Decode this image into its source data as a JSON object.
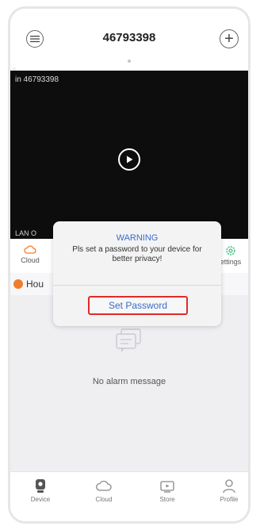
{
  "header": {
    "title": "46793398",
    "add_glyph": "+"
  },
  "video": {
    "device_id": "in 46793398",
    "status": "LAN O"
  },
  "actions": {
    "left_label": "Cloud",
    "right_label": "ettings"
  },
  "alarm": {
    "section_label": "Hou",
    "empty_message": "No alarm message"
  },
  "dialog": {
    "title": "WARNING",
    "message": "Pls set a password to your device for better privacy!",
    "button_label": "Set Password"
  },
  "tabbar": {
    "items": [
      {
        "label": "Device",
        "icon": "device-icon"
      },
      {
        "label": "Cloud",
        "icon": "cloud-icon"
      },
      {
        "label": "Store",
        "icon": "store-icon"
      },
      {
        "label": "Profile",
        "icon": "profile-icon"
      }
    ]
  },
  "colors": {
    "accent_blue": "#3b6bc9",
    "highlight_red": "#e12a2a",
    "settings_green": "#3fbf7f",
    "cloud_orange": "#f07d2a"
  }
}
